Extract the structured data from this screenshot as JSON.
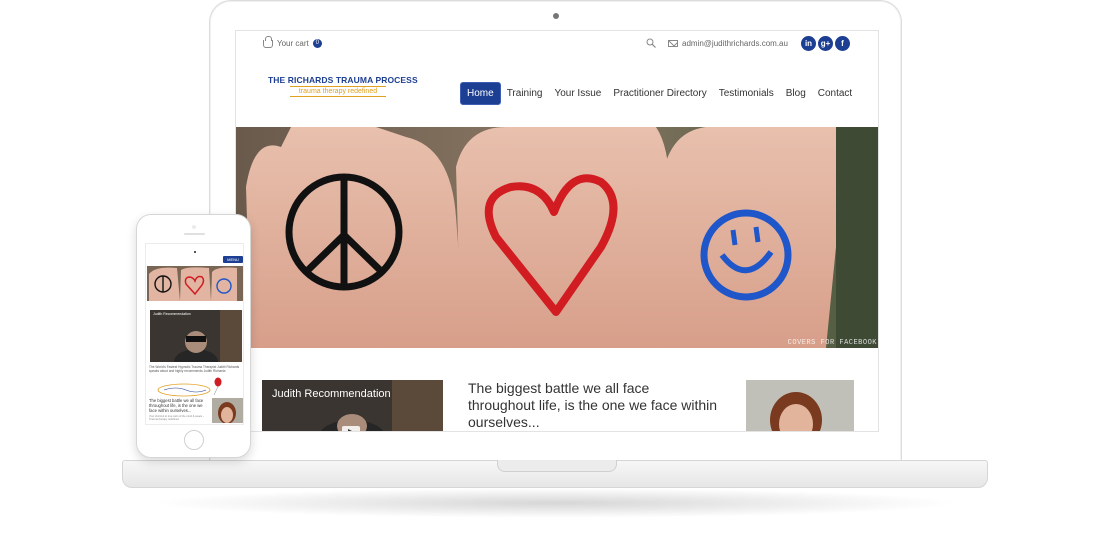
{
  "header": {
    "cart_label": "Your cart",
    "cart_count": "0",
    "email": "admin@judithrichards.com.au",
    "social": [
      {
        "label": "in",
        "icon": "linkedin-icon"
      },
      {
        "label": "g+",
        "icon": "google-plus-icon"
      },
      {
        "label": "f",
        "icon": "facebook-icon"
      }
    ]
  },
  "logo": {
    "title": "THE RICHARDS TRAUMA PROCESS",
    "tagline": "trauma therapy redefined"
  },
  "nav": {
    "items": [
      "Home",
      "Training",
      "Your Issue",
      "Practitioner Directory",
      "Testimonials",
      "Blog",
      "Contact"
    ],
    "active": "Home"
  },
  "hero": {
    "caption": "COVERS FOR FACEBOOK"
  },
  "content": {
    "video_title": "Judith Recommendation",
    "quote": "The biggest battle we all face throughout life, is the one we face within ourselves..."
  },
  "mobile": {
    "menu_label": "MENU",
    "video_title": "Judith Recommendation",
    "intro_text": "The World's Fastest Hypnotic Trauma Therapist Judith Richards speaks about and highly recommends Judith Richards",
    "quote": "The biggest battle we all face throughout life, is the one we face within ourselves...",
    "small_text": "Your shortcut to true calm of the mind & peace - Trauma therapy redefined"
  },
  "colors": {
    "brand_blue": "#1d3f93",
    "tagline_orange": "#e0a020",
    "text": "#333333"
  }
}
